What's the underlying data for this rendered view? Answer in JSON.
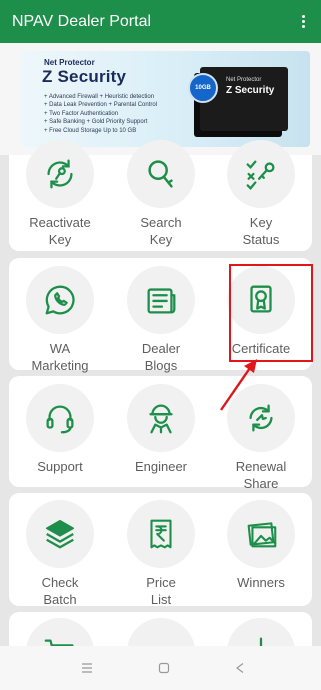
{
  "appbar": {
    "title": "NPAV Dealer Portal",
    "menu_icon": "kebab-menu-icon"
  },
  "banner": {
    "brand": "Net Protector",
    "title": "Z Security",
    "features": [
      "+ Advanced Firewall + Heuristic detection",
      "+ Data Leak Prevention + Parental Control",
      "+ Two Factor Authentication",
      "+ Safe Banking + Gold Priority Support",
      "+ Free Cloud Storage Up to 10 GB"
    ],
    "box_label": "Net Protector",
    "box_title": "Z Security",
    "cloud_badge": "10GB"
  },
  "tiles": {
    "reactivate_key": {
      "line1": "Reactivate",
      "line2": "Key"
    },
    "search_key": {
      "line1": "Search",
      "line2": "Key"
    },
    "key_status": {
      "line1": "Key",
      "line2": "Status"
    },
    "wa_marketing": {
      "line1": "WA",
      "line2": "Marketing"
    },
    "dealer_blogs": {
      "line1": "Dealer",
      "line2": "Blogs"
    },
    "certificate": {
      "line1": "Certificate"
    },
    "support": {
      "line1": "Support"
    },
    "engineer": {
      "line1": "Engineer"
    },
    "renewal_share": {
      "line1": "Renewal",
      "line2": "Share"
    },
    "check_batch": {
      "line1": "Check",
      "line2": "Batch"
    },
    "price_list": {
      "line1": "Price",
      "line2": "List"
    },
    "winners": {
      "line1": "Winners"
    }
  },
  "colors": {
    "primary": "#1e8f4a",
    "icon": "#1e8f4a",
    "highlight": "#e0161b",
    "label": "#5e5e5e"
  }
}
